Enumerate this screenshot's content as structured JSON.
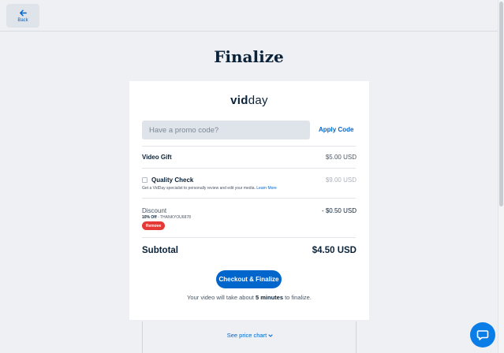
{
  "header": {
    "back_label": "Back"
  },
  "page": {
    "title": "Finalize"
  },
  "card": {
    "logo_bold": "vid",
    "logo_light": "day",
    "promo": {
      "placeholder": "Have a promo code?",
      "apply_label": "Apply Code"
    },
    "video_gift": {
      "label": "Video Gift",
      "price": "$5.00 USD"
    },
    "quality_check": {
      "label": "Quality Check",
      "checked": false,
      "description": "Get a VidDay specialist to personally review and edit your media.",
      "learn_more": "Learn More",
      "price": "$9.00 USD"
    },
    "discount": {
      "label": "Discount",
      "amount": "- $0.50 USD",
      "percent": "10% Off",
      "code": "THANKYOU6878",
      "remove_label": "Remove"
    },
    "subtotal": {
      "label": "Subtotal",
      "value": "$4.50 USD"
    },
    "checkout_label": "Checkout & Finalize",
    "note_prefix": "Your video will take about",
    "note_bold": "5 minutes",
    "note_suffix": "to finalize."
  },
  "price_chart": {
    "label": "See price chart"
  },
  "colors": {
    "accent": "#0066cc",
    "danger": "#e53935",
    "heading": "#0a2239",
    "background": "#eef0f4"
  },
  "icons": {
    "back": "arrow-left-icon",
    "chevron": "chevron-down-icon",
    "chat": "chat-bubble-icon"
  }
}
